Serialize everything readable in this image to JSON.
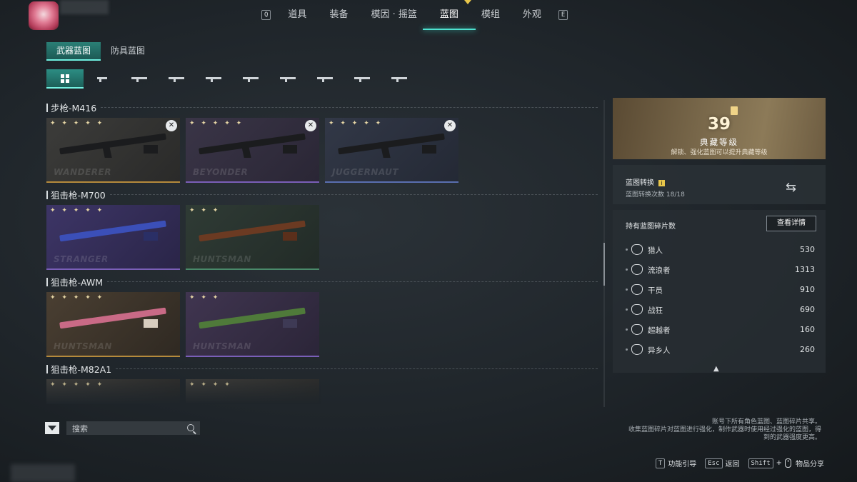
{
  "top_nav": {
    "left_key": "Q",
    "right_key": "E",
    "tabs": [
      "道具",
      "装备",
      "模因 · 摇篮",
      "蓝图",
      "模组",
      "外观"
    ],
    "active_tab": "蓝图"
  },
  "sub_tabs": [
    "武器蓝图",
    "防具蓝图"
  ],
  "weapon_filters": [
    "all-grid-icon",
    "pistol-icon",
    "sniper-icon",
    "smg-icon",
    "assault-rifle-icon",
    "rifle-icon",
    "shotgun-icon",
    "lmg-icon",
    "launcher-icon",
    "dmr-icon"
  ],
  "categories": [
    {
      "title": "步枪-M416",
      "cards": [
        {
          "stars": "✦ ✦ ✦ ✦ ✦",
          "skin": "WANDERER",
          "locked": true
        },
        {
          "stars": "✦ ✦ ✦ ✦ ✦",
          "skin": "BEYONDER",
          "locked": true
        },
        {
          "stars": "✦ ✦ ✦ ✦ ✦",
          "skin": "JUGGERNAUT",
          "locked": true
        }
      ]
    },
    {
      "title": "狙击枪-M700",
      "cards": [
        {
          "stars": "✦ ✦ ✦ ✦ ✦",
          "skin": "STRANGER",
          "locked": false
        },
        {
          "stars": "✦ ✦ ✦",
          "skin": "HUNTSMAN",
          "locked": false
        }
      ]
    },
    {
      "title": "狙击枪-AWM",
      "cards": [
        {
          "stars": "✦ ✦ ✦ ✦ ✦",
          "skin": "HUNTSMAN",
          "locked": false
        },
        {
          "stars": "✦ ✦ ✦",
          "skin": "HUNTSMAN",
          "locked": false
        }
      ]
    },
    {
      "title": "狙击枪-M82A1",
      "cards": [
        {
          "stars": "✦ ✦ ✦ ✦ ✦",
          "skin": "",
          "locked": false
        },
        {
          "stars": "✦ ✦ ✦ ✦",
          "skin": "",
          "locked": false
        }
      ]
    }
  ],
  "search": {
    "placeholder": "搜索"
  },
  "collection": {
    "level": "39",
    "title": "典藏等级",
    "desc": "解锁、强化蓝图可以提升典藏等级"
  },
  "conversion": {
    "title": "蓝图转换",
    "info": "i",
    "count_label": "蓝图转换次数 18/18"
  },
  "fragments": {
    "title": "持有蓝图碎片数",
    "details_button": "查看详情",
    "items": [
      {
        "name": "猎人",
        "value": "530"
      },
      {
        "name": "流浪者",
        "value": "1313"
      },
      {
        "name": "干员",
        "value": "910"
      },
      {
        "name": "战狂",
        "value": "690"
      },
      {
        "name": "超越者",
        "value": "160"
      },
      {
        "name": "异乡人",
        "value": "260"
      }
    ]
  },
  "note": {
    "line1": "账号下所有角色蓝图、蓝图碎片共享。",
    "line2": "收集蓝图碎片对蓝图进行强化，制作武器时使用经过强化的蓝图，得",
    "line3": "到的武器强度更高。"
  },
  "hotkeys": [
    {
      "key": "T",
      "label": "功能引导"
    },
    {
      "key": "Esc",
      "label": "返回"
    },
    {
      "key": "Shift",
      "plus": "+",
      "label": "物品分享"
    }
  ],
  "colors": {
    "accent": "#4ee2d0",
    "gold": "#e8c64a"
  }
}
